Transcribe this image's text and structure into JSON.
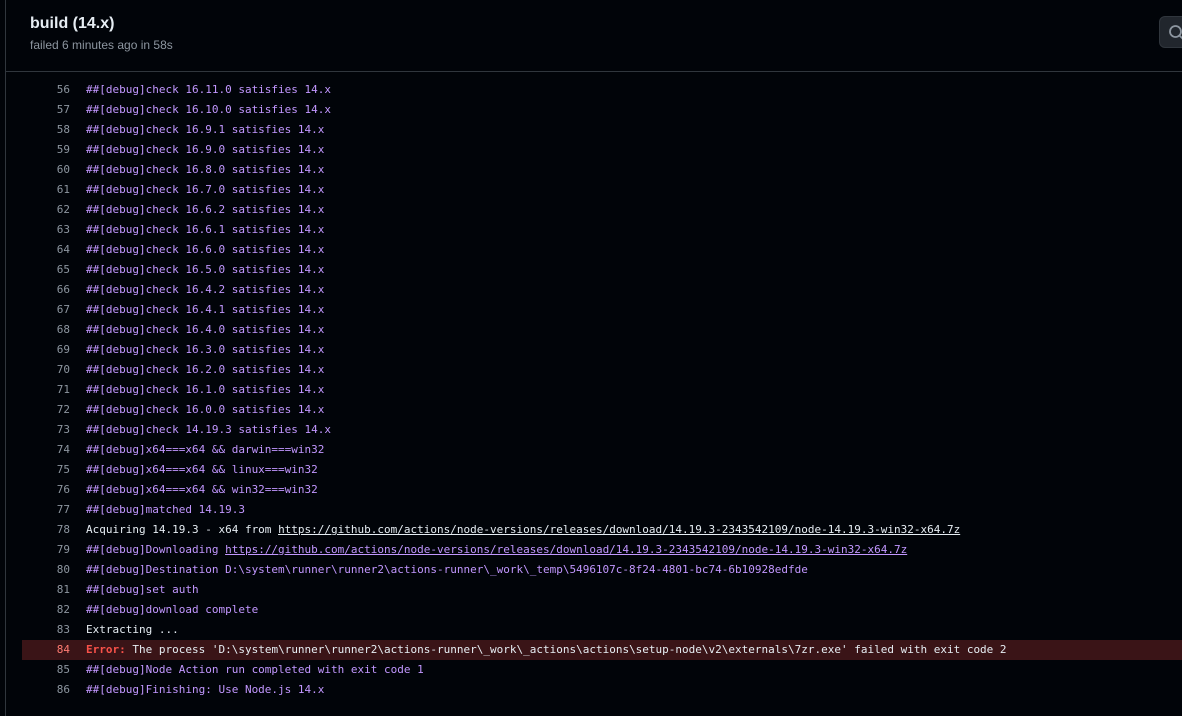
{
  "header": {
    "title": "build (14.x)",
    "status": "failed 6 minutes ago in 58s",
    "search_icon": "search-icon"
  },
  "colors": {
    "debug": "#c297ff",
    "normal": "#e6edf3",
    "error_bg": "#3a1417",
    "error_label": "#f85149"
  },
  "log": [
    {
      "n": "56",
      "kind": "debug",
      "text": "##[debug]check 16.11.0 satisfies 14.x"
    },
    {
      "n": "57",
      "kind": "debug",
      "text": "##[debug]check 16.10.0 satisfies 14.x"
    },
    {
      "n": "58",
      "kind": "debug",
      "text": "##[debug]check 16.9.1 satisfies 14.x"
    },
    {
      "n": "59",
      "kind": "debug",
      "text": "##[debug]check 16.9.0 satisfies 14.x"
    },
    {
      "n": "60",
      "kind": "debug",
      "text": "##[debug]check 16.8.0 satisfies 14.x"
    },
    {
      "n": "61",
      "kind": "debug",
      "text": "##[debug]check 16.7.0 satisfies 14.x"
    },
    {
      "n": "62",
      "kind": "debug",
      "text": "##[debug]check 16.6.2 satisfies 14.x"
    },
    {
      "n": "63",
      "kind": "debug",
      "text": "##[debug]check 16.6.1 satisfies 14.x"
    },
    {
      "n": "64",
      "kind": "debug",
      "text": "##[debug]check 16.6.0 satisfies 14.x"
    },
    {
      "n": "65",
      "kind": "debug",
      "text": "##[debug]check 16.5.0 satisfies 14.x"
    },
    {
      "n": "66",
      "kind": "debug",
      "text": "##[debug]check 16.4.2 satisfies 14.x"
    },
    {
      "n": "67",
      "kind": "debug",
      "text": "##[debug]check 16.4.1 satisfies 14.x"
    },
    {
      "n": "68",
      "kind": "debug",
      "text": "##[debug]check 16.4.0 satisfies 14.x"
    },
    {
      "n": "69",
      "kind": "debug",
      "text": "##[debug]check 16.3.0 satisfies 14.x"
    },
    {
      "n": "70",
      "kind": "debug",
      "text": "##[debug]check 16.2.0 satisfies 14.x"
    },
    {
      "n": "71",
      "kind": "debug",
      "text": "##[debug]check 16.1.0 satisfies 14.x"
    },
    {
      "n": "72",
      "kind": "debug",
      "text": "##[debug]check 16.0.0 satisfies 14.x"
    },
    {
      "n": "73",
      "kind": "debug",
      "text": "##[debug]check 14.19.3 satisfies 14.x"
    },
    {
      "n": "74",
      "kind": "debug",
      "text": "##[debug]x64===x64 && darwin===win32"
    },
    {
      "n": "75",
      "kind": "debug",
      "text": "##[debug]x64===x64 && linux===win32"
    },
    {
      "n": "76",
      "kind": "debug",
      "text": "##[debug]x64===x64 && win32===win32"
    },
    {
      "n": "77",
      "kind": "debug",
      "text": "##[debug]matched 14.19.3"
    },
    {
      "n": "78",
      "kind": "normal",
      "text": "Acquiring 14.19.3 - x64 from ",
      "link": "https://github.com/actions/node-versions/releases/download/14.19.3-2343542109/node-14.19.3-win32-x64.7z"
    },
    {
      "n": "79",
      "kind": "debug",
      "text": "##[debug]Downloading ",
      "link": "https://github.com/actions/node-versions/releases/download/14.19.3-2343542109/node-14.19.3-win32-x64.7z"
    },
    {
      "n": "80",
      "kind": "debug",
      "text": "##[debug]Destination D:\\system\\runner\\runner2\\actions-runner\\_work\\_temp\\5496107c-8f24-4801-bc74-6b10928edfde"
    },
    {
      "n": "81",
      "kind": "debug",
      "text": "##[debug]set auth"
    },
    {
      "n": "82",
      "kind": "debug",
      "text": "##[debug]download complete"
    },
    {
      "n": "83",
      "kind": "normal",
      "text": "Extracting ..."
    },
    {
      "n": "84",
      "kind": "error",
      "label": "Error:",
      "text": " The process 'D:\\system\\runner\\runner2\\actions-runner\\_work\\_actions\\actions\\setup-node\\v2\\externals\\7zr.exe' failed with exit code 2"
    },
    {
      "n": "85",
      "kind": "debug",
      "text": "##[debug]Node Action run completed with exit code 1"
    },
    {
      "n": "86",
      "kind": "debug",
      "text": "##[debug]Finishing: Use Node.js 14.x"
    }
  ]
}
